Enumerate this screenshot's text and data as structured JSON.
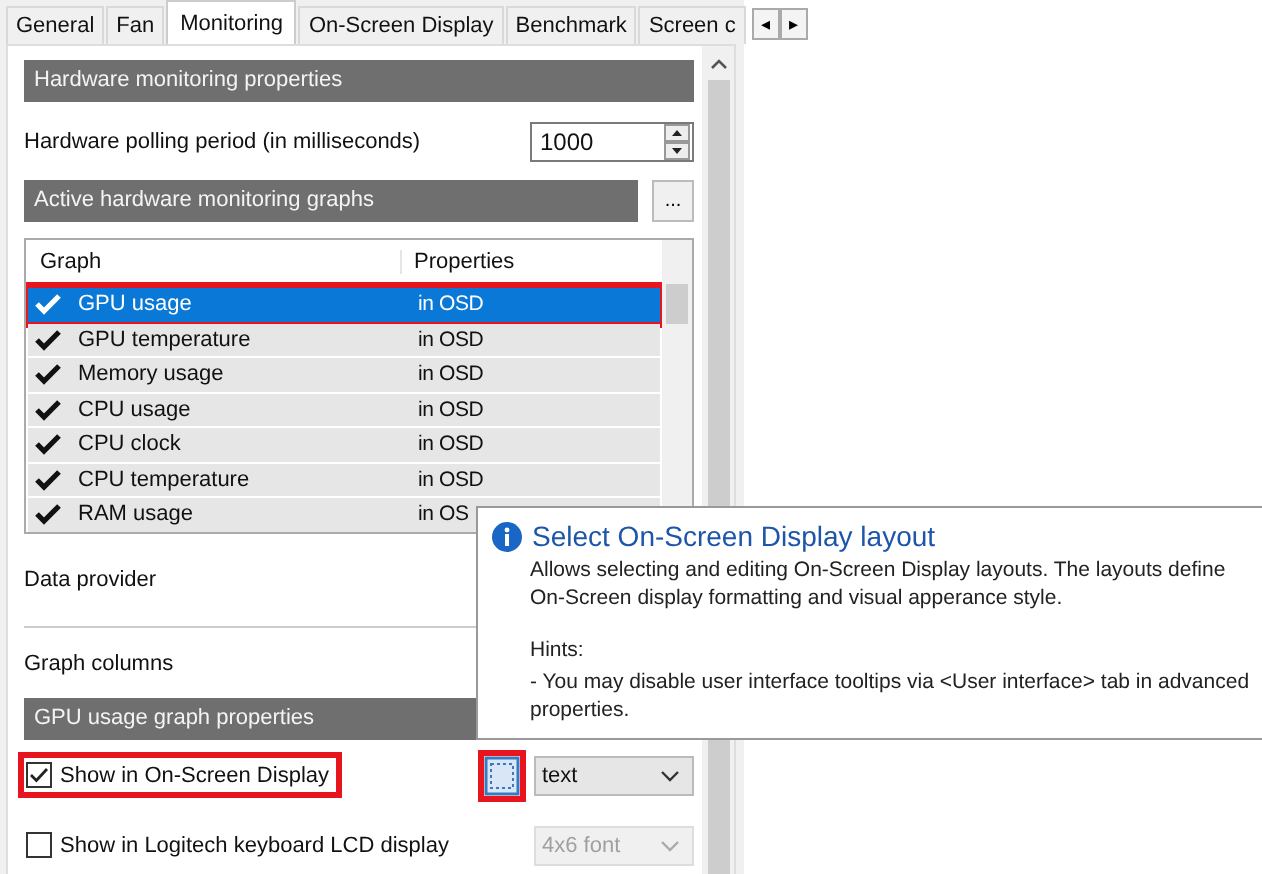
{
  "tabs": [
    {
      "label": "General",
      "selected": false
    },
    {
      "label": "Fan",
      "selected": false
    },
    {
      "label": "Monitoring",
      "selected": true
    },
    {
      "label": "On-Screen Display",
      "selected": false
    },
    {
      "label": "Benchmark",
      "selected": false
    },
    {
      "label": "Screen c",
      "selected": false
    }
  ],
  "tab_scroll": [
    "◂",
    "▸"
  ],
  "sections": {
    "hardware": "Hardware monitoring properties",
    "graphs": "Active hardware monitoring graphs",
    "graph_props": "GPU usage graph properties"
  },
  "polling": {
    "label": "Hardware polling period (in milliseconds)",
    "value": "1000"
  },
  "graphs_button": "...",
  "graph_list": {
    "columns": [
      "Graph",
      "Properties"
    ],
    "rows": [
      {
        "name": "GPU usage",
        "properties": "in OSD",
        "checked": true,
        "selected": true,
        "highlighted": true
      },
      {
        "name": "GPU temperature",
        "properties": "in OSD",
        "checked": true,
        "selected": false,
        "highlighted": false
      },
      {
        "name": "Memory usage",
        "properties": "in OSD",
        "checked": true,
        "selected": false,
        "highlighted": false
      },
      {
        "name": "CPU usage",
        "properties": "in OSD",
        "checked": true,
        "selected": false,
        "highlighted": false
      },
      {
        "name": "CPU clock",
        "properties": "in OSD",
        "checked": true,
        "selected": false,
        "highlighted": false
      },
      {
        "name": "CPU temperature",
        "properties": "in OSD",
        "checked": true,
        "selected": false,
        "highlighted": false
      },
      {
        "name": "RAM usage",
        "properties": "in OS",
        "checked": true,
        "selected": false,
        "highlighted": false
      }
    ]
  },
  "data_provider": {
    "label": "Data provider"
  },
  "graph_columns": {
    "label": "Graph columns"
  },
  "options": [
    {
      "label": "Show in On-Screen Display",
      "checked": true,
      "highlighted": true,
      "select": "text",
      "select_disabled": false,
      "layout_button": true,
      "layout_highlighted": true
    },
    {
      "label": "Show in Logitech keyboard LCD display",
      "checked": false,
      "highlighted": false,
      "select": "4x6 font",
      "select_disabled": true,
      "layout_button": false
    }
  ],
  "tooltip": {
    "title": "Select On-Screen Display layout",
    "text": "Allows selecting and editing On-Screen Display layouts. The layouts define On-Screen display formatting and visual apperance style.",
    "hints_title": "Hints:",
    "hints": "- You may disable user interface tooltips via <User interface> tab in advanced properties."
  }
}
